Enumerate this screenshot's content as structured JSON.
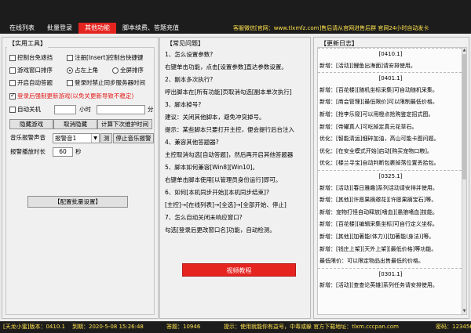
{
  "tabs": [
    "在线列表",
    "批量登录",
    "其他功能",
    "脚本续费、答题充值"
  ],
  "active_tab": 2,
  "top_notice": "客服微信[官网：www.tlxmfz.com]售后请从官网进售后群 官网24小时自动发卡",
  "left": {
    "title": "【实用工具】",
    "opt_console_hide": "控制台免遮挡",
    "opt_register_hotkey": "注册[Insert]控制台快捷键",
    "opt_window_sort": "游戏窗口排序",
    "radio_top_left": "占左上角",
    "radio_fullscreen": "全屏排序",
    "opt_auto_answer": "开启自动答题",
    "opt_block_sync": "登录时禁止同步服务器时间",
    "opt_force_update": "登录后强制更新游戏(以免关更新导致不稳定)",
    "auto_close_label": "自动关机",
    "hour_unit": "小时",
    "minute_unit": "分",
    "btn_hide_game": "隐藏游戏",
    "btn_cancel_hide": "取消隐藏",
    "btn_next_maintenance": "计算下次维护时间",
    "music_label": "音乐报警声音",
    "music_selected": "报警音1",
    "btn_test": "测",
    "btn_stop_music": "停止音乐报警",
    "alarm_duration_label": "报警播放时长",
    "alarm_duration_value": "60",
    "seconds_unit": "秒",
    "btn_config_batch": "【配置批量设置】"
  },
  "mid": {
    "title": "【常见问题】",
    "lines": [
      "1、怎么设置参数?",
      "右键单击功能，点击[设置参数]直达参数设置。",
      "2、副本多次执行?",
      "呼出脚本在[所有功能]页取消勾选[副本单次执行]",
      "3、脚本掉号?",
      "建议：关闭其他脚本，避免冲突掉号。",
      "提示：某些脚本只要打开主控，便会提行后台注入",
      "4、兼容其他答题器?",
      "主控取消勾选[自动答题]，然后再开启其他答题器",
      "5、脚本如何兼容[Win8][Win10]。",
      "右键单击脚本使用[以管理员身份运行]即可。",
      "6、如何[本机同步开始][本机同步结束]?",
      "[主控]→[在线列表]→[全选]→[全部开始、停止]",
      "7、怎么自动关闭未响应窗口?",
      "勾选[登录后更改窗口名]功能，自动检测。"
    ],
    "btn_video": "视频教程"
  },
  "right": {
    "title": "【更新日志】",
    "lines": [
      "[0410.1]",
      "新增：[活动][鲤鱼出海面]请安排使用。",
      "[0401.1]",
      "新增：[百花楼][随机坐标采集]可自动随机采集。",
      "新增：[商会管理][最低限价]可以限制最低价格。",
      "新增：[抢李乐窥]可以用橙点抢购鉴定招式图。",
      "新增：[帝罐真人]可吃掉定真元花草石。",
      "优化：[智能清运]细碎加油，高山可能卡图问题。",
      "优化：[在安全模式开始]启动[购买宠物口粮]。",
      "优化：[楼兰寻宝]自动判断包裹掉落位置丢拾包。",
      "[0325.1]",
      "新增：[活动][春日雅趣]系列活动请安排并使用。",
      "新增：[其他][许愿果摘邀花][许愿果摘宝石]等。",
      "新增：宠物打怪自动释放[嗜血][愚狼嗜血]技能。",
      "新增：[百花楼][编辑采集坐标]可自行定义坐标。",
      "新增：[其他][加著能(体力)][加著能(身法)]等。",
      "新增：[钱庄上架][天外上架][最低价格]等功能。",
      "最低限价：可以限定物品出售最低的价格。",
      "[0301.1]",
      "新增：[活动][查查论英雄]系列任务请安排使用。"
    ]
  },
  "status": {
    "version": "[天龙小蜜]版本：0410.1",
    "expiry": "到期：2020-5-08 15:26:48",
    "answers": "答题：10946",
    "tip": "提示：使用就能你有益号，中毒或躲 官方下载地址：tlxm.cccpan.com",
    "password": "密码：123456"
  }
}
